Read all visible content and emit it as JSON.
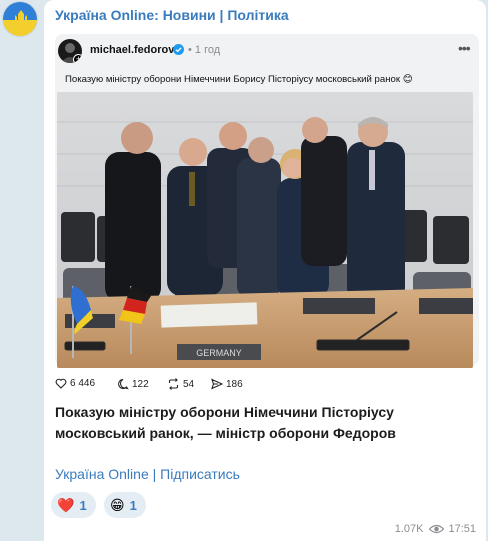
{
  "channel": {
    "title": "Україна Online: Новини | Політика",
    "footer_link": "Україна Online | Підписатись"
  },
  "embed": {
    "username": "michael.fedorov",
    "time_ago": "1 год",
    "caption": "Показую міністру оборони Німеччини Борису Пісторіусу московський ранок 😊",
    "photo_nameplate": "GERMANY",
    "stats": {
      "likes": "6 446",
      "comments": "122",
      "reposts": "54",
      "shares": "186"
    }
  },
  "post_text": "Показую міністру оборони Німеччини Пісторіусу московський ранок, — міністр оборони Федоров",
  "reactions": [
    {
      "emoji": "❤️",
      "count": "1"
    },
    {
      "emoji": "😁",
      "count": "1"
    }
  ],
  "meta": {
    "views": "1.07K",
    "time": "17:51"
  },
  "icons": {
    "more": "more-dots-icon",
    "verified": "verified-badge-icon",
    "like": "heart-icon",
    "comment": "comment-icon",
    "repost": "repost-icon",
    "share": "share-icon",
    "views": "eye-icon"
  },
  "colors": {
    "accent": "#3a7bbd",
    "background": "#dde7ee",
    "verified": "#1d9bf0"
  }
}
